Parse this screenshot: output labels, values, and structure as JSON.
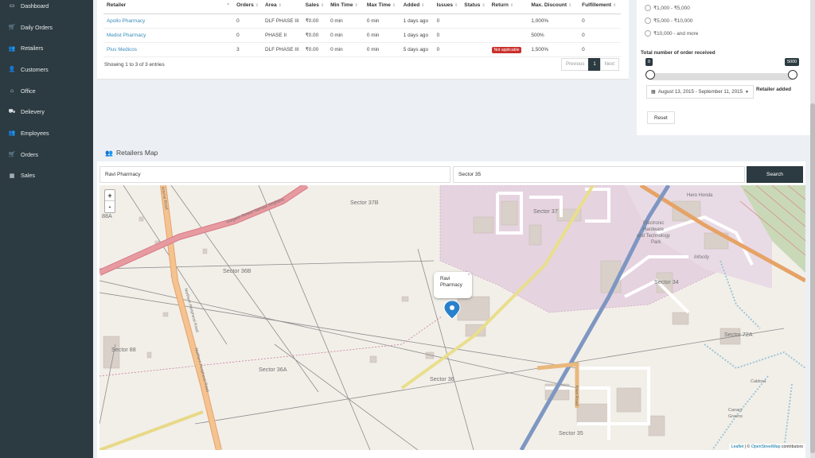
{
  "sidebar": {
    "items": [
      {
        "label": "Dashboard",
        "icon": "desktop-icon"
      },
      {
        "label": "Daily Orders",
        "icon": "cart-icon"
      },
      {
        "label": "Retailers",
        "icon": "users-icon"
      },
      {
        "label": "Customers",
        "icon": "user-icon"
      },
      {
        "label": "Office",
        "icon": "home-icon"
      },
      {
        "label": "Delievery",
        "icon": "truck-icon"
      },
      {
        "label": "Employees",
        "icon": "users-icon"
      },
      {
        "label": "Orders",
        "icon": "cart-icon"
      },
      {
        "label": "Sales",
        "icon": "chart-icon"
      }
    ]
  },
  "table": {
    "headers": [
      "Retailer",
      "Orders",
      "Area",
      "Sales",
      "Min Time",
      "Max Time",
      "Added",
      "Issues",
      "Status",
      "Return",
      "Max. Discount",
      "Fulfillement"
    ],
    "rows": [
      {
        "retailer": "Apollo Pharmacy",
        "orders": "0",
        "area": "DLF PHASE III",
        "sales": "₹0.00",
        "min": "0 min",
        "max": "0 min",
        "added": "1 days ago",
        "issues": "0",
        "status": "",
        "return": "",
        "discount": "1,000%",
        "fulfill": "0"
      },
      {
        "retailer": "Medist Pharmacy",
        "orders": "0",
        "area": "PHASE II",
        "sales": "₹0.00",
        "min": "0 min",
        "max": "0 min",
        "added": "1 days ago",
        "issues": "0",
        "status": "",
        "return": "",
        "discount": "500%",
        "fulfill": "0"
      },
      {
        "retailer": "Plus Medicos",
        "orders": "3",
        "area": "DLF PHASE III",
        "sales": "₹0.00",
        "min": "0 min",
        "max": "0 min",
        "added": "5 days ago",
        "issues": "0",
        "status": "",
        "return": "Not applicable",
        "discount": "1,500%",
        "fulfill": "0"
      }
    ],
    "showing": "Showing 1 to 3 of 3 entries",
    "pager": {
      "prev": "Previous",
      "page": "1",
      "next": "Next"
    }
  },
  "filters": {
    "ranges": [
      "₹1,000 - ₹5,000",
      "₹5,000 - ₹10,000",
      "₹10,000 - and more"
    ],
    "order_title": "Total number of order received",
    "slider_min": "0",
    "slider_max": "5000",
    "date_range": "August 13, 2015 - September 11, 2015",
    "retailer_added": "Retailer added",
    "reset": "Reset"
  },
  "map": {
    "title": "Retailers Map",
    "retailer_value": "Ravi Pharmacy",
    "sector_value": "Sector 35",
    "search_label": "Search",
    "zoom_in": "+",
    "zoom_out": "-",
    "popup_line1": "Ravi",
    "popup_line2": "Pharmacy",
    "popup_close": "×",
    "attribution_leaflet": "Leaflet",
    "attribution_sep": " | © ",
    "attribution_osm": "OpenStreetMap",
    "attribution_tail": " contributors",
    "labels": {
      "s37b": "Sector 37B",
      "s37": "Sector 37",
      "s36b": "Sector 36B",
      "s88": "Sector 88",
      "s88a": "88A",
      "s36a": "Sector 36A",
      "s36": "Sector 36",
      "s34": "Sector 34",
      "s72a": "Sector 72A",
      "s35": "Sector 35",
      "hero": "Hero Honda",
      "park1": "Electronic",
      "park2": "Hardware",
      "park3": "and Technology",
      "park4": "Park",
      "infocity": "Infocity",
      "caldora": "Caldora",
      "canary1": "Canary",
      "canary2": "Greens",
      "kheri": "Kheri Road",
      "arterial": "Arterial Road",
      "npr1": "Northern Peripheral Road",
      "npr2": "Northern Peripheral Road",
      "grr": "Gurgaon Rewari Narnaul Singhana"
    }
  }
}
